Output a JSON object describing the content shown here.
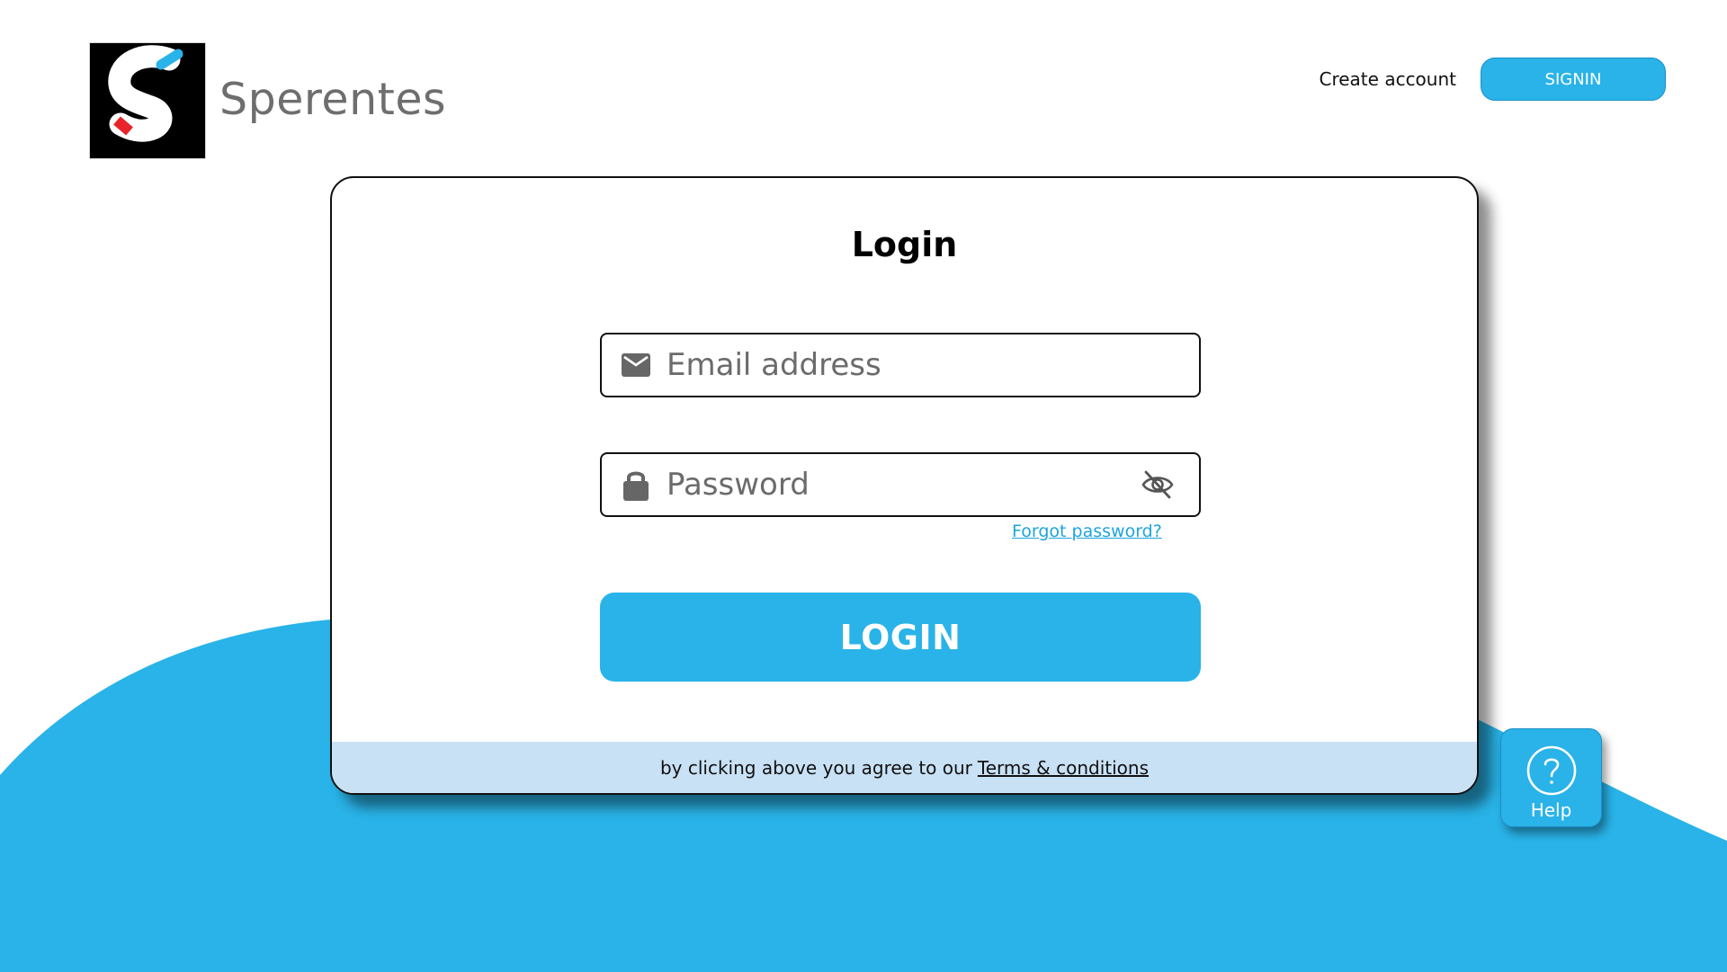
{
  "brand": {
    "name": "Sperentes",
    "logo_colors": {
      "background": "#000000",
      "letter": "#ffffff",
      "top_accent": "#29b3e8",
      "bottom_accent": "#e8232a"
    }
  },
  "header": {
    "create_account_label": "Create account",
    "signin_label": "SIGNIN"
  },
  "login_card": {
    "title": "Login",
    "email": {
      "placeholder": "Email address",
      "value": "",
      "icon": "mail-icon"
    },
    "password": {
      "placeholder": "Password",
      "value": "",
      "icon": "lock-icon",
      "toggle_icon": "eye-off-icon"
    },
    "forgot_password_label": "Forgot password?",
    "login_button_label": "LOGIN",
    "footer": {
      "agreement_text": "by clicking above you agree to our",
      "terms_link_label": "Terms & conditions"
    }
  },
  "help": {
    "label": "Help",
    "icon": "help-circle-icon"
  },
  "colors": {
    "accent": "#29b3e8",
    "footer_bg": "#c9e1f5",
    "link": "#1ea4dd"
  }
}
